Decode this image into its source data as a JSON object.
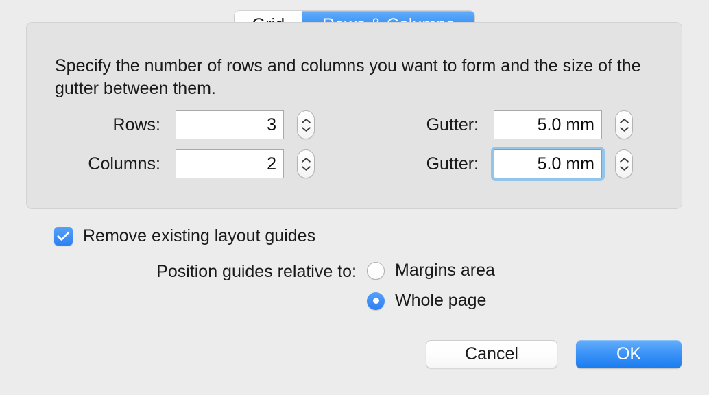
{
  "tabs": [
    {
      "label": "Grid",
      "active": false
    },
    {
      "label": "Rows & Columns",
      "active": true
    }
  ],
  "group": {
    "description": "Specify the number of rows and columns you want to form and the size of the gutter between them.",
    "fields": [
      {
        "label": "Rows:",
        "value": "3"
      },
      {
        "label": "Columns:",
        "value": "2"
      },
      {
        "label": "Gutter:",
        "value": "5.0 mm"
      },
      {
        "label": "Gutter:",
        "value": "5.0 mm"
      }
    ]
  },
  "options": {
    "remove_guides_label": "Remove existing layout guides",
    "remove_guides_checked": true,
    "position_prompt": "Position guides relative to:",
    "radios": [
      {
        "label": "Margins area",
        "selected": false
      },
      {
        "label": "Whole page",
        "selected": true
      }
    ]
  },
  "footer": {
    "cancel_label": "Cancel",
    "ok_label": "OK"
  },
  "colors": {
    "accent_blue": "#3e94f7",
    "focus_ring": "#93c4ea",
    "window_bg": "#ececec",
    "group_bg": "#e3e3e3"
  }
}
